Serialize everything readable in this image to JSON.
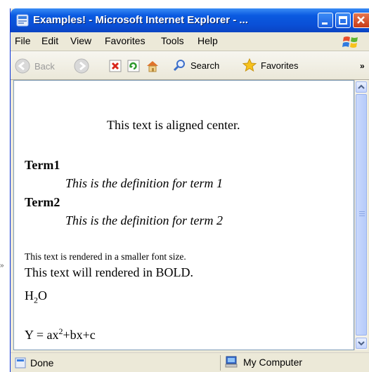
{
  "window": {
    "title": "Examples! - Microsoft Internet Explorer - ..."
  },
  "menu": [
    "File",
    "Edit",
    "View",
    "Favorites",
    "Tools",
    "Help"
  ],
  "toolbar": {
    "back": "Back",
    "search": "Search",
    "favorites": "Favorites",
    "overflow": "»"
  },
  "page": {
    "center_text": "This text is aligned center.",
    "dl": [
      {
        "term": "Term1",
        "definition": "This is the definition for term 1"
      },
      {
        "term": "Term2",
        "definition": "This is the definition for term 2"
      }
    ],
    "small_text": "This text is rendered in a smaller font size.",
    "bold_text": "This text will rendered in BOLD.",
    "formula_h2o": {
      "base": "H",
      "sub": "2",
      "tail": "O"
    },
    "formula_poly": {
      "lhs": "Y = ax",
      "sup": "2",
      "rhs": "+bx+c"
    }
  },
  "status": {
    "left": "Done",
    "zone": "My Computer"
  },
  "outside_marker": "»",
  "colors": {
    "titlebar": "#0a4fd6",
    "chrome": "#ece9d8",
    "content_bg": "#ffffff"
  }
}
